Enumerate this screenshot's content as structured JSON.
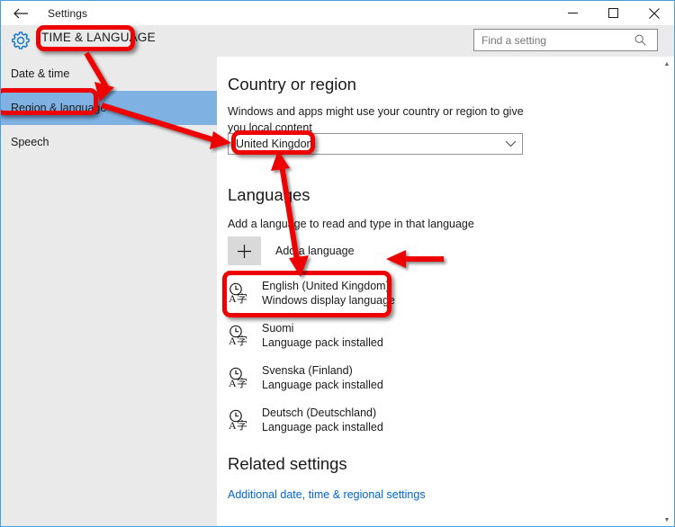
{
  "window": {
    "title": "Settings",
    "back_icon": "back-arrow-icon",
    "controls": {
      "minimize": "minimize-icon",
      "maximize": "maximize-icon",
      "close": "close-icon"
    },
    "border_color": "#4a9ddb"
  },
  "header": {
    "gear_icon": "gear-icon",
    "gear_color": "#0078d7",
    "title": "TIME & LANGUAGE",
    "band_color": "#eaeaea"
  },
  "search": {
    "placeholder": "Find a setting",
    "value": "",
    "icon": "search-icon"
  },
  "sidebar": {
    "selected_color": "#7fb2e3",
    "items": [
      {
        "label": "Date & time",
        "selected": false
      },
      {
        "label": "Region & language",
        "selected": true
      },
      {
        "label": "Speech",
        "selected": false
      }
    ]
  },
  "content": {
    "country": {
      "title": "Country or region",
      "description": "Windows and apps might use your country or region to give you local content",
      "selected": "United Kingdom",
      "chevron_icon": "chevron-down-icon"
    },
    "languages": {
      "title": "Languages",
      "description": "Add a language to read and type in that language",
      "add_label": "Add a language",
      "add_icon": "plus-icon",
      "items": [
        {
          "icon": "language-icon",
          "name": "English (United Kingdom)",
          "status": "Windows display language"
        },
        {
          "icon": "language-icon",
          "name": "Suomi",
          "status": "Language pack installed"
        },
        {
          "icon": "language-icon",
          "name": "Svenska (Finland)",
          "status": "Language pack installed"
        },
        {
          "icon": "language-icon",
          "name": "Deutsch (Deutschland)",
          "status": "Language pack installed"
        }
      ]
    },
    "related": {
      "title": "Related settings",
      "link": "Additional date, time & regional settings",
      "link_color": "#0066cc"
    }
  },
  "scrollbar": {
    "up_icon": "scroll-up-icon",
    "down_icon": "scroll-down-icon",
    "up_glyph": "▲",
    "down_glyph": "▼"
  },
  "annotations": {
    "color": "#ee0000",
    "highlight_boxes": [
      {
        "name": "time-and-language-header",
        "target": "TIME & LANGUAGE"
      },
      {
        "name": "region-and-language-nav",
        "target": "Region & language"
      },
      {
        "name": "country-value",
        "target": "United Kingdom"
      },
      {
        "name": "english-language-item",
        "target": "English (United Kingdom)"
      }
    ],
    "arrows": [
      {
        "name": "header-to-nav-arrow",
        "from": "TIME & LANGUAGE",
        "to": "Region & language"
      },
      {
        "name": "nav-to-country-arrow",
        "from": "Region & language",
        "to": "United Kingdom"
      },
      {
        "name": "country-to-language-arrow",
        "from": "United Kingdom",
        "to": "English (United Kingdom)",
        "double_headed": true
      }
    ]
  }
}
